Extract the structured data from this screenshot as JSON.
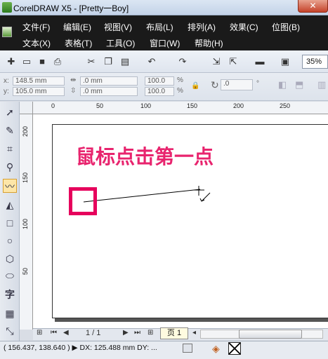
{
  "window": {
    "title": "CorelDRAW X5 - [Pretty一Boy]",
    "close_label": "✕"
  },
  "menu": {
    "row1": [
      "文件(F)",
      "编辑(E)",
      "视图(V)",
      "布局(L)",
      "排列(A)",
      "效果(C)",
      "位图(B)"
    ],
    "row2": [
      "文本(X)",
      "表格(T)",
      "工具(O)",
      "窗口(W)",
      "帮助(H)"
    ]
  },
  "toolbar": {
    "zoom": "35%"
  },
  "properties": {
    "x_label": "x:",
    "y_label": "y:",
    "x": "148.5 mm",
    "y": "105.0 mm",
    "w": ".0 mm",
    "h": ".0 mm",
    "scale_w": "100.0",
    "scale_h": "100.0",
    "percent": "%",
    "rotation": ".0",
    "degree": "°"
  },
  "rulers": {
    "h_ticks": [
      "0",
      "50",
      "100",
      "150",
      "200",
      "250"
    ],
    "v_ticks": [
      "200",
      "150",
      "100",
      "50"
    ]
  },
  "annotation": {
    "text": "鼠标点击第一点",
    "color": "#e8246e"
  },
  "doc_nav": {
    "page_counter": "1 / 1",
    "page_tab": "页 1"
  },
  "status": {
    "text": "( 156.437, 138.640 )  ▶  DX: 125.488 mm DY: ..."
  }
}
